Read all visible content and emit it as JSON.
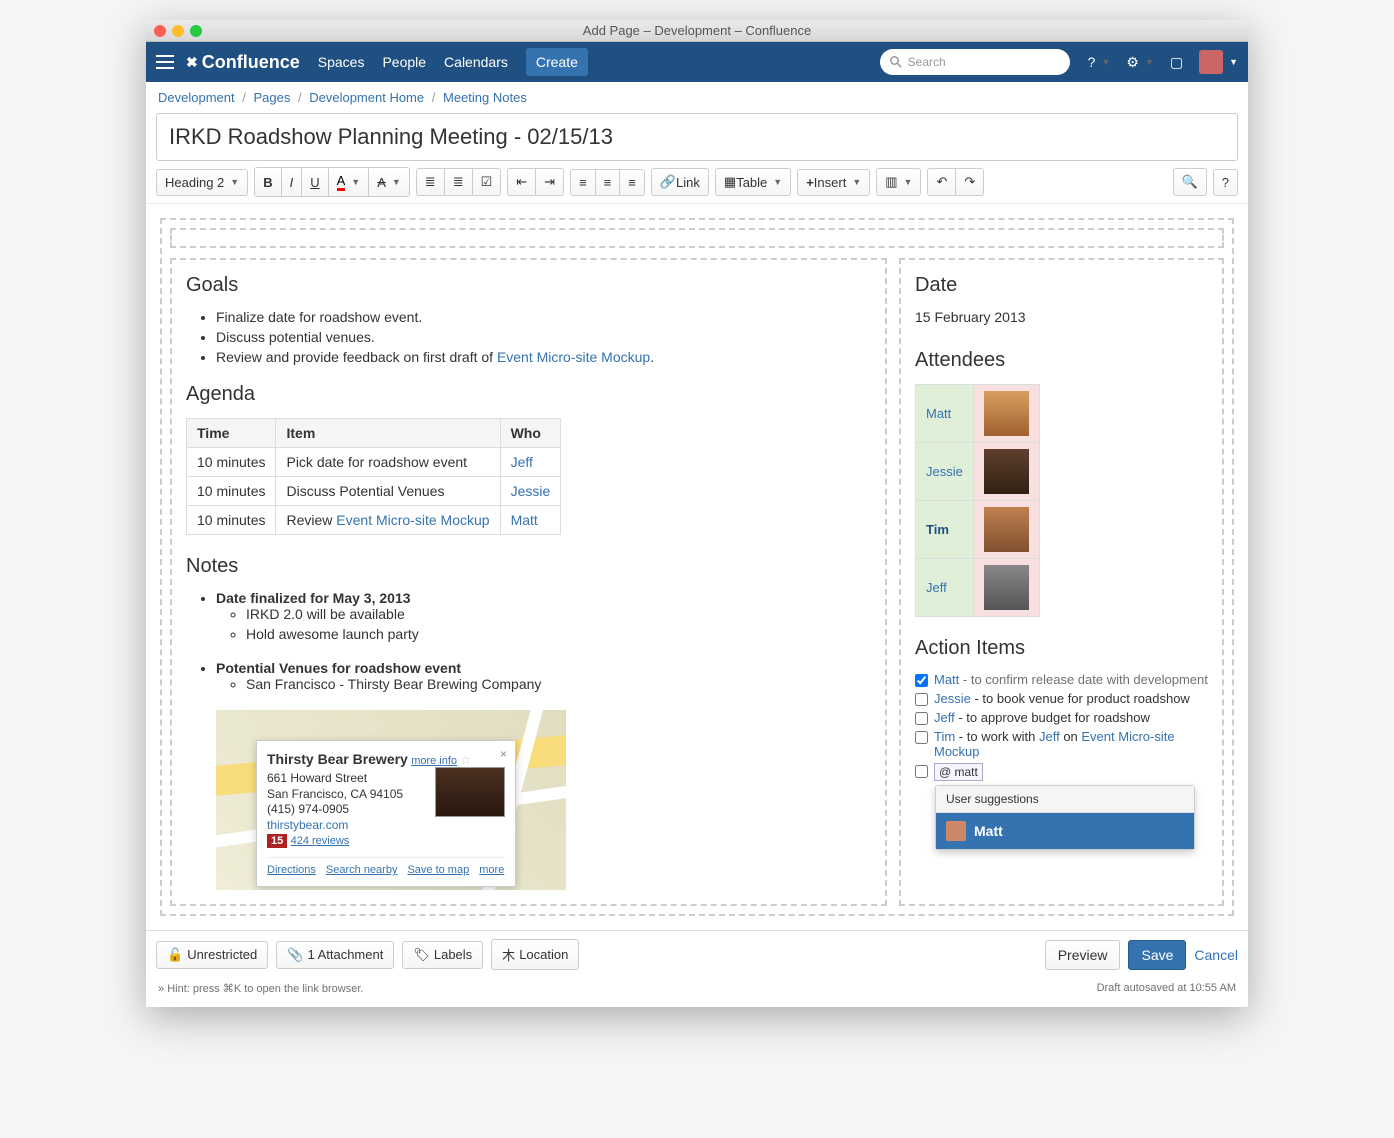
{
  "window": {
    "title": "Add Page – Development – Confluence"
  },
  "nav": {
    "logo": "Confluence",
    "links": [
      "Spaces",
      "People",
      "Calendars"
    ],
    "create": "Create",
    "search_placeholder": "Search"
  },
  "breadcrumb": [
    "Development",
    "Pages",
    "Development Home",
    "Meeting Notes"
  ],
  "page_title": "IRKD Roadshow Planning Meeting - 02/15/13",
  "toolbar": {
    "style": "Heading 2",
    "link": "Link",
    "table": "Table",
    "insert": "Insert"
  },
  "main": {
    "goals_h": "Goals",
    "goals": [
      "Finalize date for roadshow event.",
      "Discuss potential venues."
    ],
    "goals_review_prefix": "Review and provide feedback on first draft of ",
    "goals_review_link": "Event Micro-site Mockup",
    "agenda_h": "Agenda",
    "agenda_headers": [
      "Time",
      "Item",
      "Who"
    ],
    "agenda_rows": [
      {
        "time": "10 minutes",
        "item": "Pick date for roadshow event",
        "who": "Jeff"
      },
      {
        "time": "10 minutes",
        "item": "Discuss Potential Venues",
        "who": "Jessie"
      },
      {
        "time": "10 minutes",
        "item_prefix": "Review ",
        "item_link": "Event Micro-site Mockup",
        "who": "Matt"
      }
    ],
    "notes_h": "Notes",
    "notes": {
      "l1a": "Date finalized for May 3, 2013",
      "l2a": "IRKD 2.0 will be available",
      "l2b": "Hold awesome launch party",
      "l1b": "Potential Venues for roadshow event",
      "l2c": "San Francisco - Thirsty Bear Brewing Company"
    },
    "map": {
      "name": "Thirsty Bear Brewery",
      "more_info": "more info",
      "addr1": "661 Howard Street",
      "addr2": "San Francisco, CA 94105",
      "phone": "(415) 974-0905",
      "site": "thirstybear.com",
      "badge": "15",
      "reviews": "424 reviews",
      "links": [
        "Directions",
        "Search nearby",
        "Save to map",
        "more"
      ]
    }
  },
  "side": {
    "date_h": "Date",
    "date": "15 February 2013",
    "attendees_h": "Attendees",
    "attendees": [
      "Matt",
      "Jessie",
      "Tim",
      "Jeff"
    ],
    "action_h": "Action Items",
    "actions": [
      {
        "checked": true,
        "user": "Matt",
        "text": " - to confirm release date with development"
      },
      {
        "checked": false,
        "user": "Jessie",
        "text": " - to book venue for product roadshow"
      },
      {
        "checked": false,
        "user": "Jeff",
        "text": " - to approve budget for roadshow"
      },
      {
        "checked": false,
        "user": "Tim",
        "text_prefix": " - to work with ",
        "user2": "Jeff",
        "text_mid": " on ",
        "link": "Event Micro-site Mockup"
      }
    ],
    "mention_val": "@ matt",
    "suggest_head": "User suggestions",
    "suggest_item": "Matt"
  },
  "footer": {
    "unrestricted": "Unrestricted",
    "attachment": "1 Attachment",
    "labels": "Labels",
    "location": "Location",
    "preview": "Preview",
    "save": "Save",
    "cancel": "Cancel",
    "hint": "Hint: press ⌘K to open the link browser.",
    "autosave": "Draft autosaved at 10:55 AM"
  }
}
